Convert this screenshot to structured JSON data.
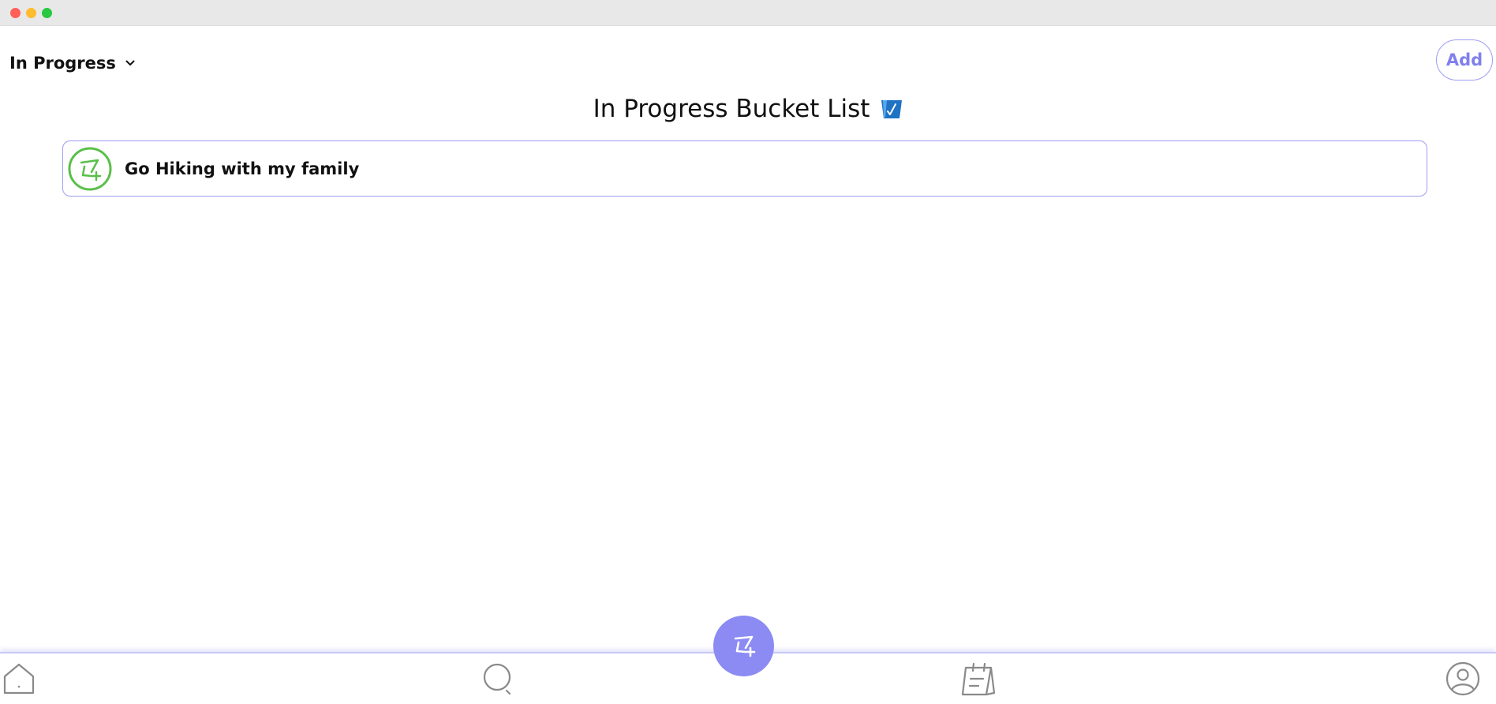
{
  "filter": {
    "selected": "In Progress",
    "chevron_icon": "chevron-down-icon"
  },
  "header": {
    "add_label": "Add"
  },
  "page": {
    "title": "In Progress Bucket List",
    "title_icon": "bucket-icon"
  },
  "bucket_list": {
    "items": [
      {
        "label": "Go Hiking with my family",
        "icon": "add-goal-icon",
        "status_color": "#5abf4a"
      }
    ]
  },
  "fab": {
    "icon": "add-goal-icon",
    "color": "#8b8bf3"
  },
  "bottom_nav": {
    "items": [
      {
        "icon": "home-icon"
      },
      {
        "icon": "search-icon"
      },
      {
        "icon": "calendar-notes-icon"
      },
      {
        "icon": "profile-icon"
      }
    ]
  },
  "colors": {
    "accent": "#8080ec",
    "border": "#9d9df2",
    "success": "#5abf4a"
  }
}
